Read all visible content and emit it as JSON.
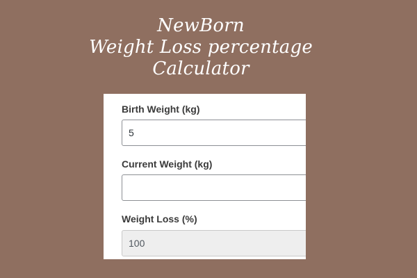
{
  "title": {
    "line1": "NewBorn",
    "line2": "Weight Loss percentage",
    "line3": "Calculator"
  },
  "form": {
    "birth_weight": {
      "label": "Birth Weight (kg)",
      "value": "5"
    },
    "current_weight": {
      "label": "Current Weight (kg)",
      "value": ""
    },
    "weight_loss": {
      "label": "Weight Loss (%)",
      "value": "100"
    }
  },
  "colors": {
    "background": "#8f6f60",
    "panel": "#ffffff",
    "readonly_field": "#eeeeee"
  }
}
